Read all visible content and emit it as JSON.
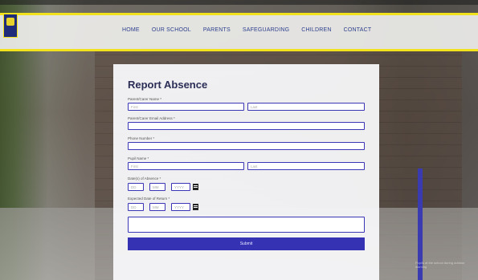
{
  "header": {
    "nav": [
      "HOME",
      "OUR SCHOOL",
      "PARENTS",
      "SAFEGUARDING",
      "CHILDREN",
      "CONTACT"
    ]
  },
  "form": {
    "title": "Report Absence",
    "fields": {
      "parent_name_label": "Parent/Carer Name *",
      "first_placeholder": "First",
      "last_placeholder": "Last",
      "email_label": "Parent/Carer Email Address *",
      "phone_label": "Phone Number *",
      "pupil_name_label": "Pupil Name *",
      "pupil_first_placeholder": "First",
      "pupil_last_placeholder": "Last",
      "absence_date_label": "Date(s) of Absence *",
      "return_date_label": "Expected Date of Return *",
      "date_dd": "DD",
      "date_mm": "MM",
      "date_yyyy": "YYYY"
    },
    "submit_label": "Submit"
  },
  "photo_credit": "Pupils at the school during outdoor learning",
  "colors": {
    "accent": "#3532b4",
    "header_border": "#f2e21d",
    "nav_text": "#2c3f8c"
  }
}
